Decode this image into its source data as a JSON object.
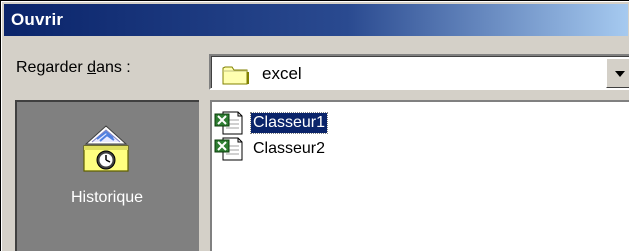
{
  "window": {
    "title": "Ouvrir"
  },
  "lookin": {
    "label_prefix": "Regarder ",
    "label_accel": "d",
    "label_suffix": "ans :",
    "current_folder": "excel"
  },
  "places": {
    "items": [
      {
        "label": "Historique",
        "icon": "history-icon"
      }
    ]
  },
  "files": [
    {
      "name": "Classeur1",
      "icon": "excel-workbook-icon",
      "selected": true
    },
    {
      "name": "Classeur2",
      "icon": "excel-workbook-icon",
      "selected": false
    }
  ],
  "colors": {
    "title_bar_start": "#0a246a",
    "title_bar_end": "#a6caf0",
    "dialog_face": "#d4d0c8",
    "places_bar": "#808080",
    "selection": "#0a246a"
  }
}
